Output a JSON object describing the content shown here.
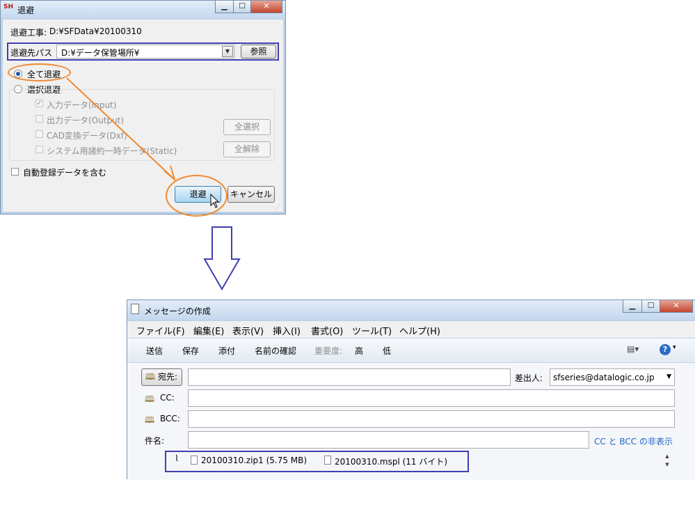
{
  "dialog": {
    "title": "退避",
    "app_icon_text": "SH",
    "project_label": "退避工事:",
    "project_value": "D:¥SFData¥20100310",
    "dest_label": "退避先パス",
    "dest_value": "D:¥データ保管場所¥",
    "browse_label": "参照",
    "radio_all": "全て退避",
    "radio_select": "選択退避",
    "options": [
      "入力データ(Input)",
      "出力データ(Output)",
      "CAD変換データ(Dxf)",
      "システム用諸約一時データ(Static)"
    ],
    "select_all_label": "全選択",
    "clear_all_label": "全解除",
    "auto_reg_label": "自動登録データを含む",
    "ok_label": "退避",
    "cancel_label": "キャンセル",
    "colors": {
      "highlight_box": "#3f3fb0",
      "annotation": "#f08a30"
    }
  },
  "mail": {
    "title": "メッセージの作成",
    "menu": [
      "ファイル(F)",
      "編集(E)",
      "表示(V)",
      "挿入(I)",
      "書式(O)",
      "ツール(T)",
      "ヘルプ(H)"
    ],
    "toolbar": [
      "送信",
      "保存",
      "添付",
      "名前の確認"
    ],
    "priority_label": "重要度:",
    "priority_high": "高",
    "priority_low": "低",
    "to_label": "宛先:",
    "cc_label": "CC:",
    "bcc_label": "BCC:",
    "subject_label": "件名:",
    "from_label": "差出人:",
    "from_value": "sfseries@datalogic.co.jp",
    "hide_cc_link": "CC と BCC の非表示",
    "attachments": [
      "20100310.zip1 (5.75 MB)",
      "20100310.mspl (11 バイト)"
    ]
  }
}
